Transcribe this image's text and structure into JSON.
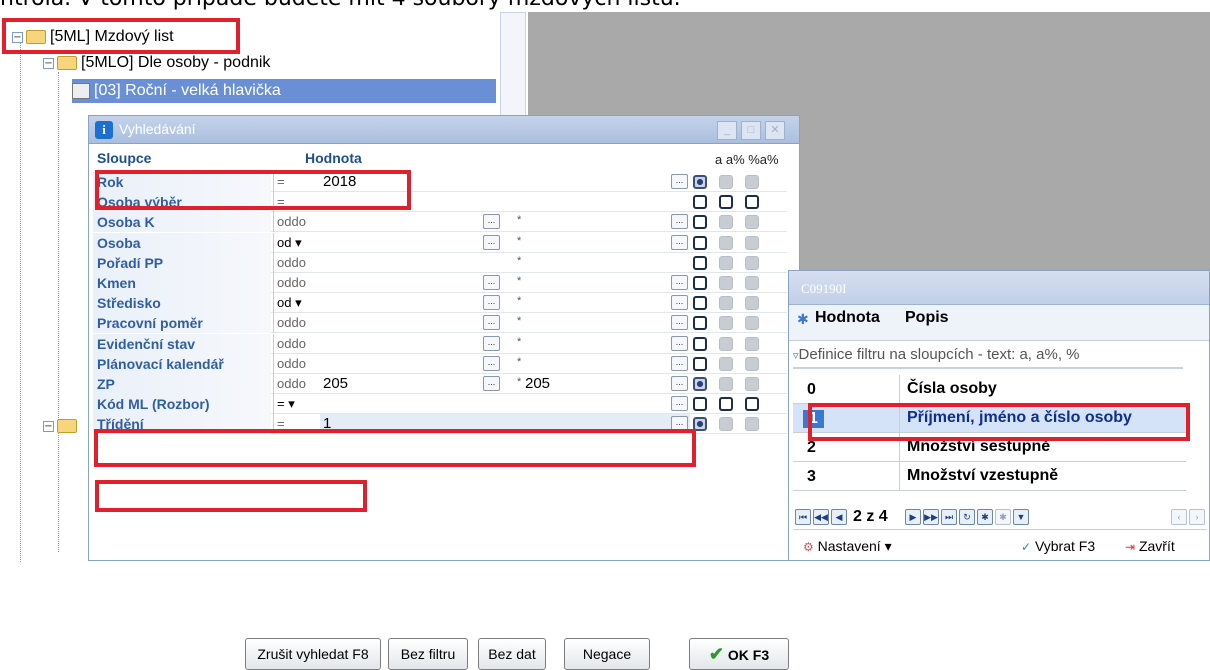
{
  "instruction_text": "ntrola. V tomto případě budete mít 4 soubory mzdových listů.",
  "tree": {
    "items": [
      {
        "label": "[5ML] Mzdový list"
      },
      {
        "label": "[5MLO]  Dle osoby - podnik"
      },
      {
        "label": "[03] Roční - velká hlavička"
      }
    ]
  },
  "dialog": {
    "title": "Vyhledávání",
    "col_header_columns": "Sloupce",
    "col_header_value": "Hodnota",
    "col_header_flags": "a  a% %a%",
    "fields": [
      {
        "name": "Rok",
        "op": "=",
        "value1": "2018",
        "value2": "",
        "radio": [
          "sel",
          "gray",
          "gray"
        ]
      },
      {
        "name": "Osoba výběr",
        "op": "=",
        "value1": "",
        "value2": "",
        "radio": [
          "empty",
          "empty",
          "empty"
        ]
      },
      {
        "name": "Osoba K",
        "op": "oddo",
        "value1": "",
        "value2": "",
        "radio": [
          "empty",
          "gray",
          "gray"
        ]
      },
      {
        "name": "Osoba",
        "op": "od ▾",
        "value1": "",
        "value2": "",
        "radio": [
          "empty",
          "gray",
          "gray"
        ]
      },
      {
        "name": "Pořadí PP",
        "op": "oddo",
        "value1": "",
        "value2": "",
        "radio": [
          "empty",
          "gray",
          "gray"
        ]
      },
      {
        "name": "Kmen",
        "op": "oddo",
        "value1": "",
        "value2": "",
        "radio": [
          "empty",
          "gray",
          "gray"
        ]
      },
      {
        "name": "Středisko",
        "op": "od ▾",
        "value1": "",
        "value2": "",
        "radio": [
          "empty",
          "gray",
          "gray"
        ]
      },
      {
        "name": "Pracovní poměr",
        "op": "oddo",
        "value1": "",
        "value2": "",
        "radio": [
          "empty",
          "gray",
          "gray"
        ]
      },
      {
        "name": "Evidenční stav",
        "op": "oddo",
        "value1": "",
        "value2": "",
        "radio": [
          "empty",
          "gray",
          "gray"
        ]
      },
      {
        "name": "Plánovací kalendář",
        "op": "oddo",
        "value1": "",
        "value2": "",
        "radio": [
          "empty",
          "gray",
          "gray"
        ]
      },
      {
        "name": "ZP",
        "op": "oddo",
        "value1": "205",
        "value2": "205",
        "radio": [
          "sel",
          "gray",
          "gray"
        ]
      },
      {
        "name": "Kód ML (Rozbor)",
        "op": "= ▾",
        "value1": "",
        "value2": "",
        "radio": [
          "empty",
          "empty",
          "empty"
        ]
      },
      {
        "name": "Třídění",
        "op": "=",
        "value1": "1",
        "value2": "",
        "radio": [
          "sel",
          "gray",
          "gray"
        ]
      }
    ],
    "buttons": {
      "cancel_search": "Zrušit vyhledat F8",
      "no_filter": "Bez filtru",
      "no_data": "Bez dat",
      "negation": "Negace",
      "ok": "OK F3"
    }
  },
  "popup": {
    "title": "C09190I",
    "col_value": "Hodnota",
    "col_desc": "Popis",
    "filter_hint": "Definice filtru na sloupcích - text: a, a%, %",
    "rows": [
      {
        "code": "0",
        "desc": "Čísla osoby"
      },
      {
        "code": "1",
        "desc": "Příjmení, jméno a číslo osoby"
      },
      {
        "code": "2",
        "desc": "Množství sestupně"
      },
      {
        "code": "3",
        "desc": "Množství vzestupně"
      }
    ],
    "page_indicator": "2 z 4",
    "settings_label": "Nastavení",
    "select_label": "Vybrat F3",
    "close_label": "Zavřít"
  },
  "colors": {
    "highlight_red": "#e0202c",
    "selection_blue": "#3c77d1",
    "field_blue": "#2f5ea5"
  }
}
